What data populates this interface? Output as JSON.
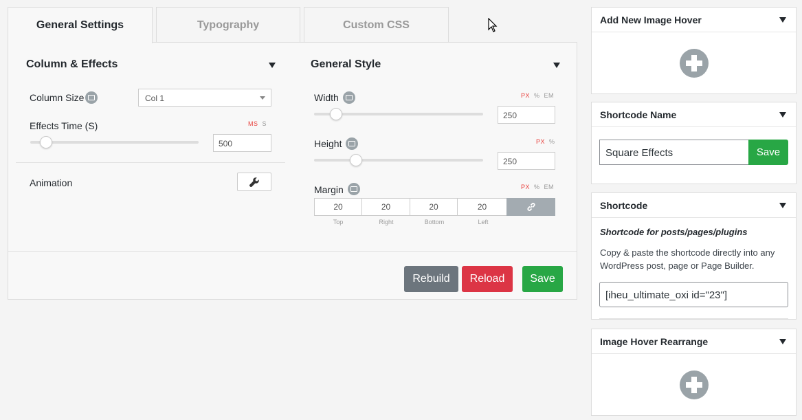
{
  "tabs": [
    {
      "label": "General Settings",
      "active": true
    },
    {
      "label": "Typography",
      "active": false
    },
    {
      "label": "Custom CSS",
      "active": false
    }
  ],
  "column_effects": {
    "title": "Column & Effects",
    "column_size": {
      "label": "Column Size",
      "value": "Col 1"
    },
    "effects_time": {
      "label": "Effects Time (S)",
      "units": [
        "MS",
        "S"
      ],
      "active_unit": "MS",
      "value": "500"
    },
    "animation": {
      "label": "Animation"
    }
  },
  "general_style": {
    "title": "General Style",
    "width": {
      "label": "Width",
      "units": [
        "PX",
        "%",
        "EM"
      ],
      "active_unit": "PX",
      "value": "250"
    },
    "height": {
      "label": "Height",
      "units": [
        "PX",
        "%"
      ],
      "active_unit": "PX",
      "value": "250"
    },
    "margin": {
      "label": "Margin",
      "units": [
        "PX",
        "%",
        "EM"
      ],
      "active_unit": "PX",
      "values": [
        "20",
        "20",
        "20",
        "20"
      ],
      "sides": [
        "Top",
        "Right",
        "Bottom",
        "Left"
      ]
    }
  },
  "actions": {
    "rebuild": "Rebuild",
    "reload": "Reload",
    "save": "Save"
  },
  "sidebar": {
    "add_new": {
      "title": "Add New Image Hover"
    },
    "shortcode_name": {
      "title": "Shortcode Name",
      "value": "Square Effects",
      "save": "Save"
    },
    "shortcode": {
      "title": "Shortcode",
      "subtitle": "Shortcode for posts/pages/plugins",
      "description": "Copy & paste the shortcode directly into any WordPress post, page or Page Builder.",
      "value": "[iheu_ultimate_oxi id=\"23\"]"
    },
    "rearrange": {
      "title": "Image Hover Rearrange"
    }
  },
  "colors": {
    "rebuild": "#6c757d",
    "reload": "#dc3545",
    "save": "#28a745",
    "unit_active": "#e8413d",
    "icon_gray": "#9aa3a8"
  }
}
